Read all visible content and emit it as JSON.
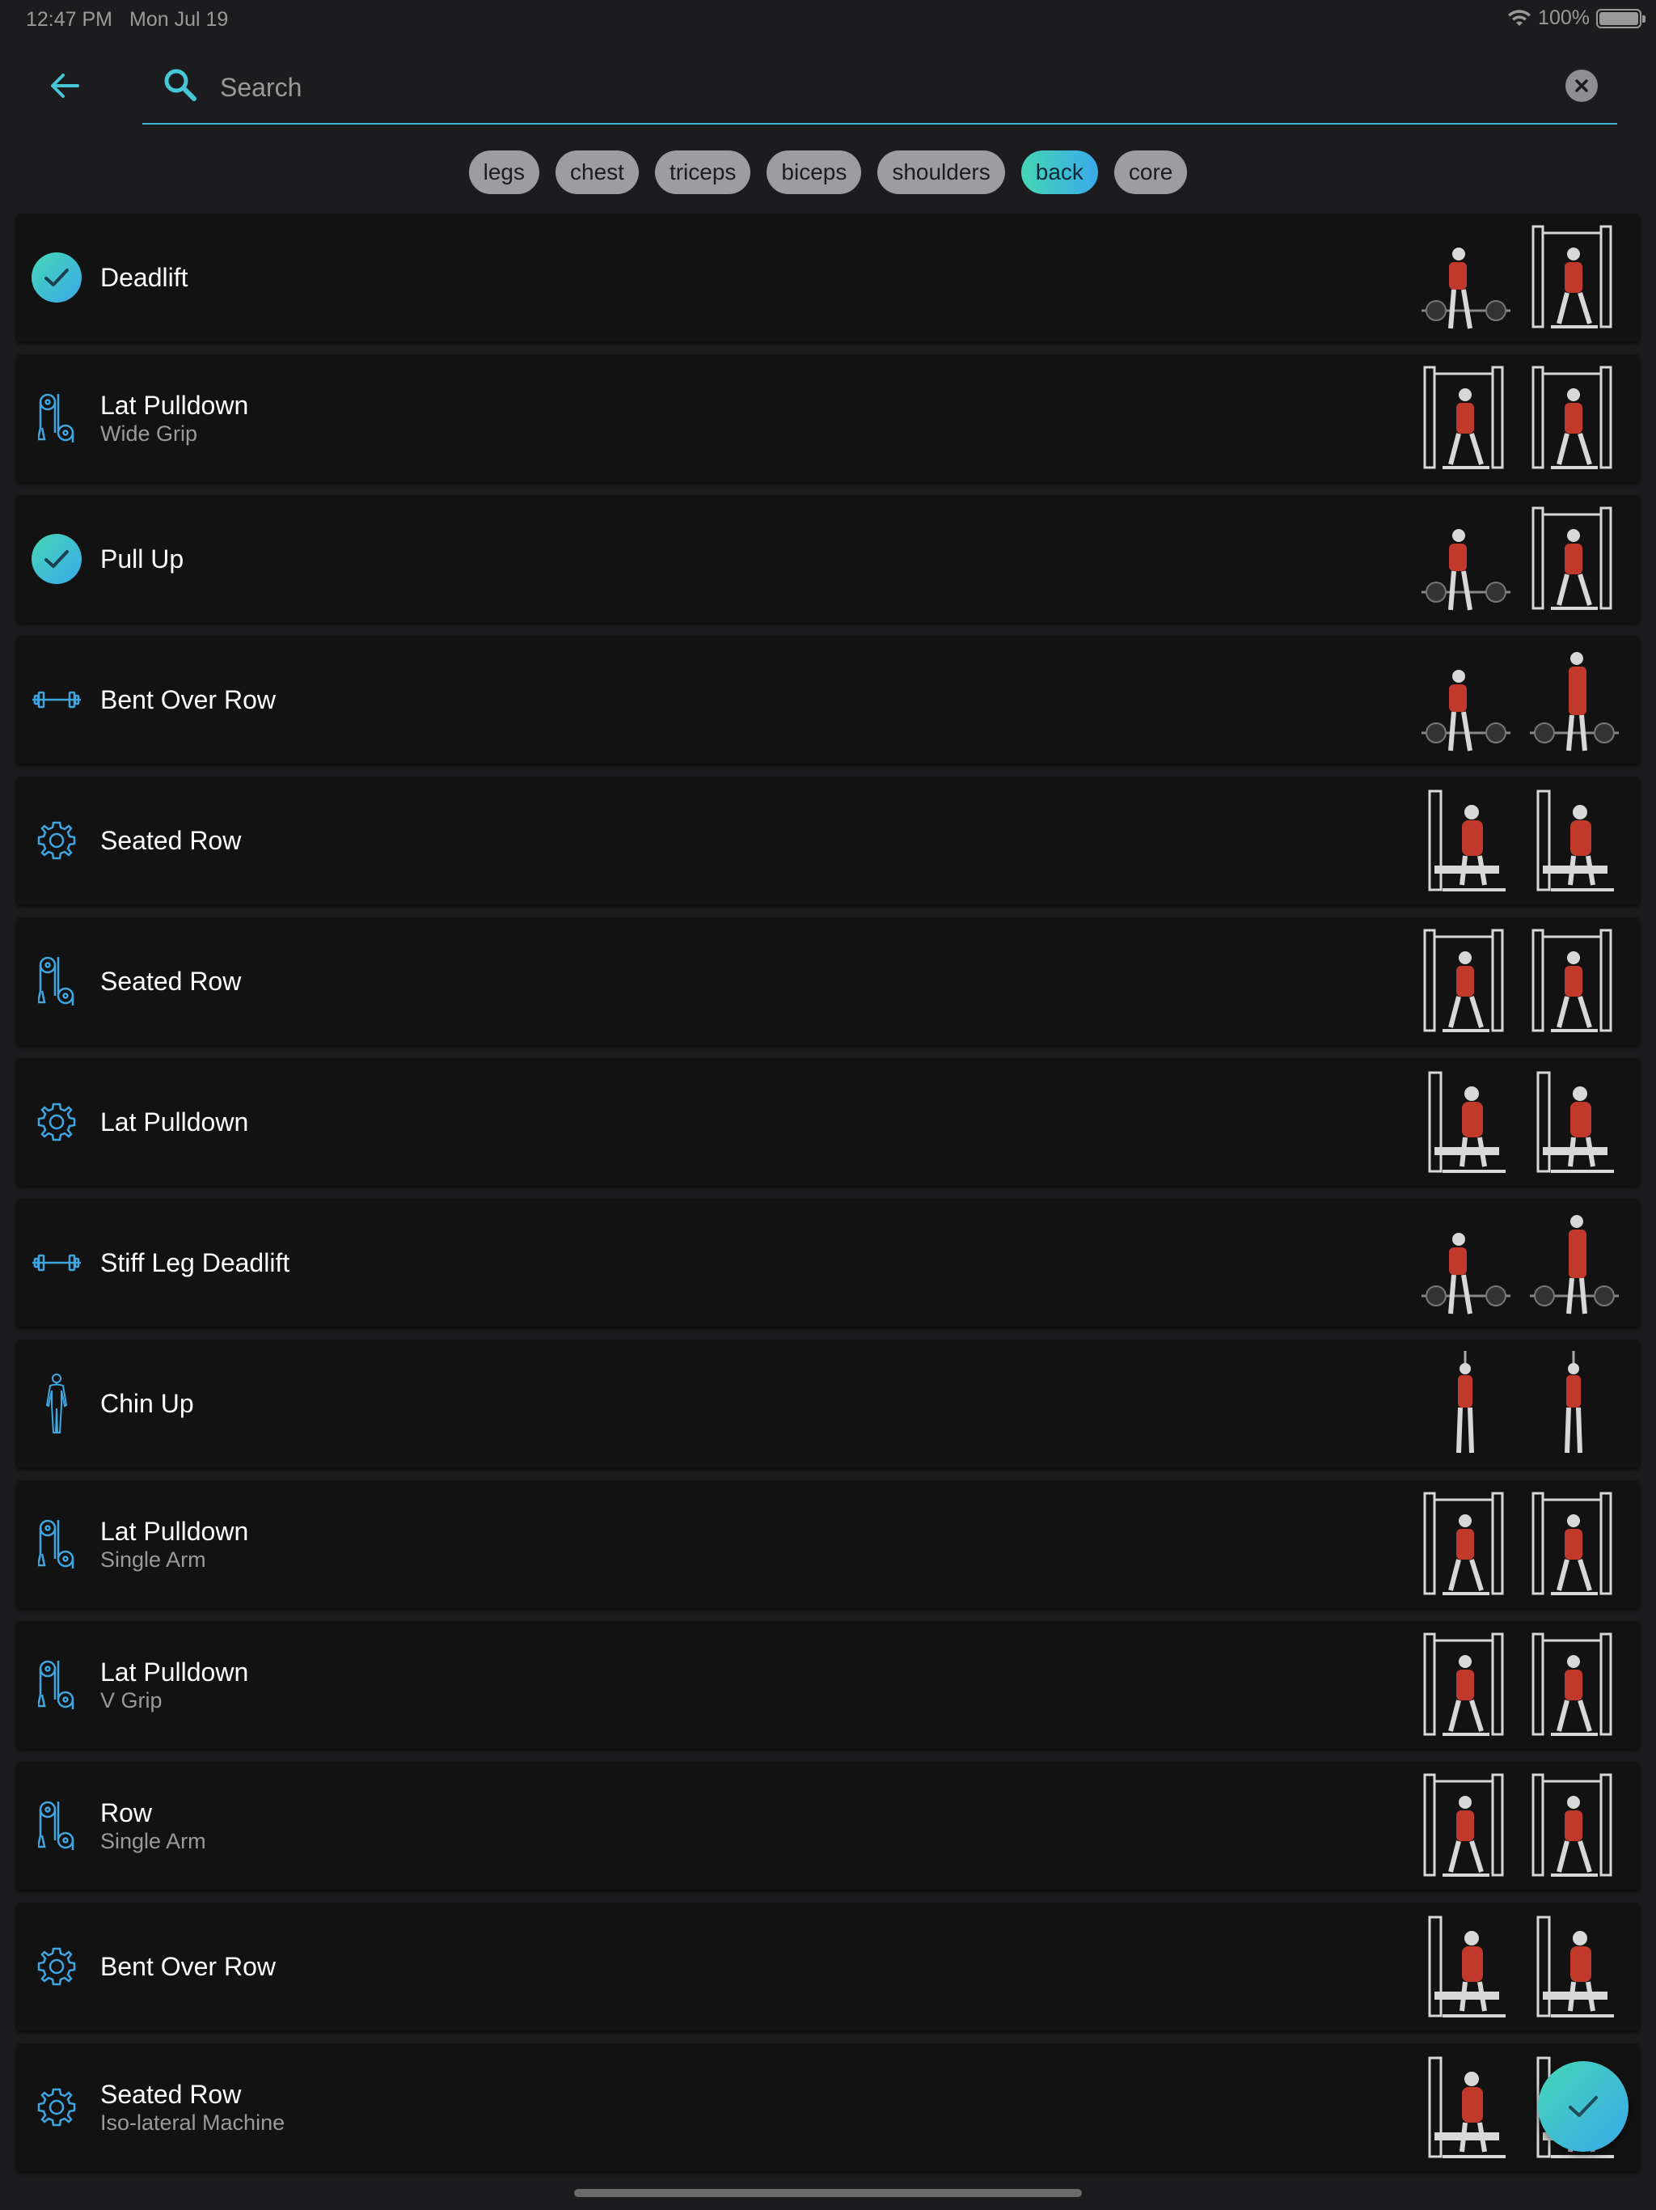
{
  "status_bar": {
    "time": "12:47 PM",
    "date": "Mon Jul 19",
    "battery": "100%"
  },
  "search": {
    "placeholder": "Search",
    "value": ""
  },
  "filters": [
    {
      "label": "legs",
      "active": false
    },
    {
      "label": "chest",
      "active": false
    },
    {
      "label": "triceps",
      "active": false
    },
    {
      "label": "biceps",
      "active": false
    },
    {
      "label": "shoulders",
      "active": false
    },
    {
      "label": "back",
      "active": true
    },
    {
      "label": "core",
      "active": false
    }
  ],
  "exercises": [
    {
      "name": "Deadlift",
      "subtitle": "",
      "icon": "check-icon",
      "selected": true
    },
    {
      "name": "Lat Pulldown",
      "subtitle": "Wide Grip",
      "icon": "cable-icon",
      "selected": false
    },
    {
      "name": "Pull Up",
      "subtitle": "",
      "icon": "check-icon",
      "selected": true
    },
    {
      "name": "Bent Over Row",
      "subtitle": "",
      "icon": "barbell-icon",
      "selected": false
    },
    {
      "name": "Seated Row",
      "subtitle": "",
      "icon": "gear-icon",
      "selected": false
    },
    {
      "name": "Seated Row",
      "subtitle": "",
      "icon": "cable-icon",
      "selected": false
    },
    {
      "name": "Lat Pulldown",
      "subtitle": "",
      "icon": "gear-icon",
      "selected": false
    },
    {
      "name": "Stiff Leg Deadlift",
      "subtitle": "",
      "icon": "barbell-icon",
      "selected": false
    },
    {
      "name": "Chin Up",
      "subtitle": "",
      "icon": "body-icon",
      "selected": false
    },
    {
      "name": "Lat Pulldown",
      "subtitle": "Single Arm",
      "icon": "cable-icon",
      "selected": false
    },
    {
      "name": "Lat Pulldown",
      "subtitle": "V Grip",
      "icon": "cable-icon",
      "selected": false
    },
    {
      "name": "Row",
      "subtitle": "Single Arm",
      "icon": "cable-icon",
      "selected": false
    },
    {
      "name": "Bent Over Row",
      "subtitle": "",
      "icon": "gear-icon",
      "selected": false
    },
    {
      "name": "Seated Row",
      "subtitle": "Iso-lateral Machine",
      "icon": "gear-icon",
      "selected": false
    }
  ],
  "colors": {
    "accent_start": "#45d6b5",
    "accent_end": "#3aa9ea",
    "icon_blue": "#3fa6e0",
    "muscle_red": "#c0392b"
  }
}
